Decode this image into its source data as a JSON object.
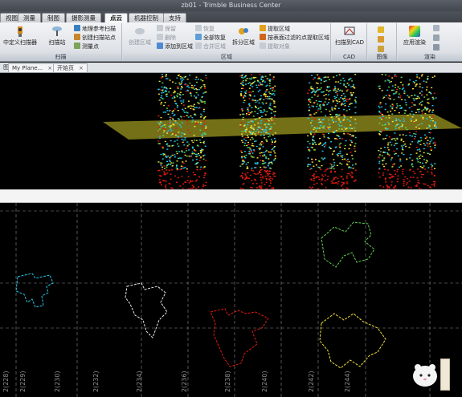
{
  "window": {
    "title": "zb01 - Trimble Business Center"
  },
  "ribbon_tabs": [
    {
      "label": "视图"
    },
    {
      "label": "测量"
    },
    {
      "label": "制图"
    },
    {
      "label": "摄影测量"
    },
    {
      "label": "点云"
    },
    {
      "label": "机器控制"
    },
    {
      "label": "支持"
    }
  ],
  "active_tab": "点云",
  "groups": {
    "scan": {
      "define_label": "中定义扫描器",
      "scan_point_label": "扫描站",
      "group_label": "扫描",
      "items": [
        "地理参考扫描",
        "创建扫描站点",
        "测量点"
      ]
    },
    "region": {
      "create_region": "创建区域",
      "items_col1": [
        "保留",
        "删除",
        "添加到区域"
      ],
      "items_col2": [
        "恢复",
        "全部恢复",
        "合并区域"
      ],
      "split_label": "拆分区域",
      "items_col3": [
        "提取区域",
        "按表面过滤的点提取区域",
        "提取对象"
      ],
      "group_label": "区域"
    },
    "cad": {
      "button_label": "扫描到CAD",
      "group_label": "CAD"
    },
    "image": {
      "group_label": "图像"
    },
    "render": {
      "button_label": "应用渲染",
      "group_label": "渲染"
    }
  },
  "doc_tabs": [
    {
      "label": "My Plane..."
    },
    {
      "label": "开始页"
    }
  ],
  "doc_left_label": "图",
  "grid_labels": [
    "2(228)",
    "2(229)",
    "2(230)",
    "2(232)",
    "2(234)",
    "2(236)",
    "2(238)",
    "2(240)",
    "2(242)",
    "2(244)"
  ],
  "colors": {
    "accent_tab": "#f6f7f8",
    "ground_plane": "#7d7a1a",
    "point_red": "#e21b10",
    "point_cyan": "#22c7e8",
    "point_yellow": "#f4e13a",
    "grid_line": "#8a8a8a"
  }
}
